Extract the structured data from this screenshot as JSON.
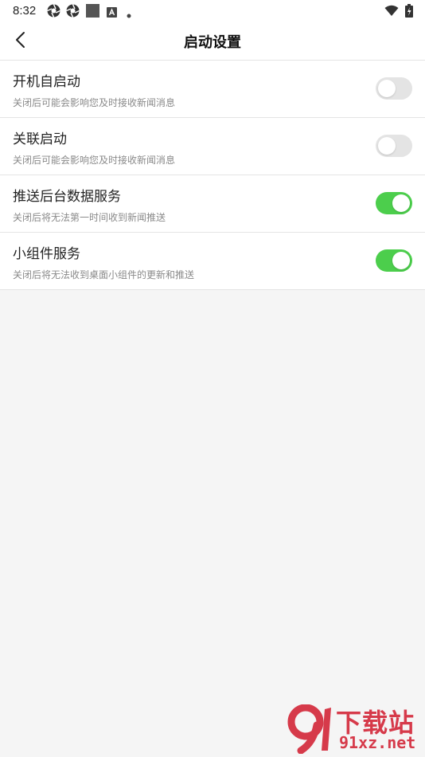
{
  "status_bar": {
    "time": "8:32",
    "icons": [
      "aperture-icon",
      "aperture-icon",
      "square-icon",
      "a-box-icon",
      "dot-icon",
      "wifi-icon",
      "battery-icon"
    ]
  },
  "header": {
    "title": "启动设置",
    "back_icon": "chevron-left-icon"
  },
  "settings": [
    {
      "title": "开机自启动",
      "description": "关闭后可能会影响您及时接收新闻消息",
      "enabled": false
    },
    {
      "title": "关联启动",
      "description": "关闭后可能会影响您及时接收新闻消息",
      "enabled": false
    },
    {
      "title": "推送后台数据服务",
      "description": "关闭后将无法第一时间收到新闻推送",
      "enabled": true
    },
    {
      "title": "小组件服务",
      "description": "关闭后将无法收到桌面小组件的更新和推送",
      "enabled": true
    }
  ],
  "colors": {
    "toggle_on": "#4cce4c",
    "toggle_off": "#e4e4e4",
    "page_background": "#f5f5f5",
    "watermark": "#d63a4a"
  },
  "watermark": {
    "logo_text": "9",
    "line1": "下载站",
    "line2": "91xz.net"
  }
}
